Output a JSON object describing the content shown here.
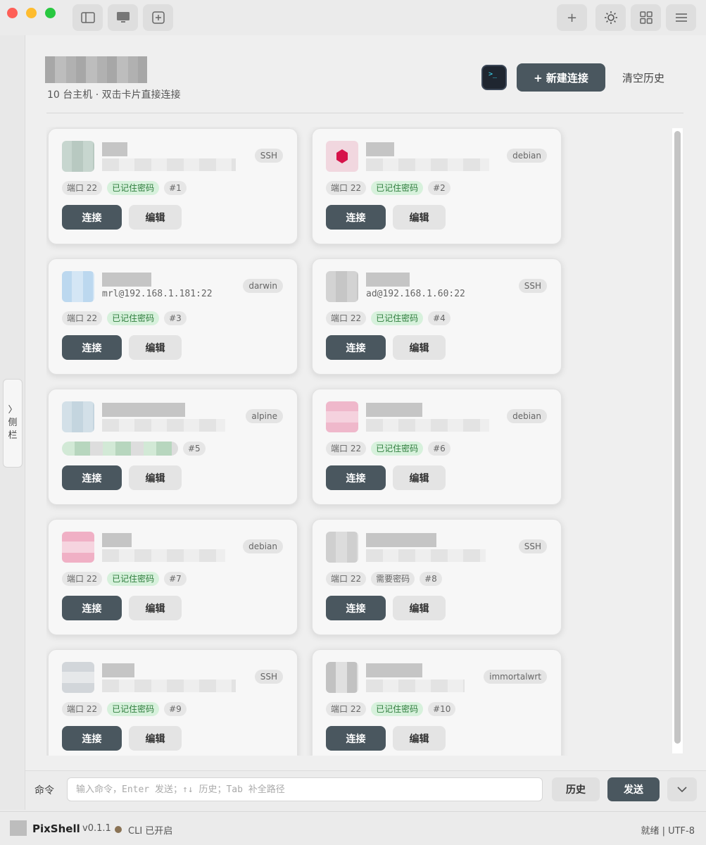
{
  "app": {
    "name": "PixShell",
    "version": "v0.1.1",
    "cli_status": "CLI 已开启",
    "status_right": "就绪 | UTF-8"
  },
  "titlebar": {
    "icons": [
      "sidebar-toggle-icon",
      "monitor-icon",
      "add-tab-icon",
      "plus-icon",
      "sun-icon",
      "grid-icon",
      "menu-icon"
    ],
    "plus_glyph": "+"
  },
  "sidebar_tab": {
    "arrow": "〉",
    "label_1": "侧",
    "label_2": "栏"
  },
  "header": {
    "subtitle": "10 台主机 · 双击卡片直接连接",
    "new_button": "+ 新建连接",
    "clear_button": "清空历史"
  },
  "colors": {
    "primary": "#4a575f",
    "green_chip_bg": "#d7f1dc",
    "green_chip_text": "#2f7d3d",
    "debian_red": "#d6134a"
  },
  "hosts": [
    {
      "os": "SSH",
      "address": "",
      "port": "端口 22",
      "auth": "已记住密码",
      "auth_ok": true,
      "index": "#1"
    },
    {
      "os": "debian",
      "address": "",
      "port": "端口 22",
      "auth": "已记住密码",
      "auth_ok": true,
      "index": "#2"
    },
    {
      "os": "darwin",
      "address": "mrl@192.168.1.181:22",
      "port": "端口 22",
      "auth": "已记住密码",
      "auth_ok": true,
      "index": "#3"
    },
    {
      "os": "SSH",
      "address": "ad@192.168.1.60:22",
      "port": "端口 22",
      "auth": "已记住密码",
      "auth_ok": true,
      "index": "#4"
    },
    {
      "os": "alpine",
      "address": "",
      "port": "",
      "auth": "",
      "auth_ok": true,
      "index": "#5"
    },
    {
      "os": "debian",
      "address": "",
      "port": "端口 22",
      "auth": "已记住密码",
      "auth_ok": true,
      "index": "#6"
    },
    {
      "os": "debian",
      "address": "",
      "port": "端口 22",
      "auth": "已记住密码",
      "auth_ok": true,
      "index": "#7"
    },
    {
      "os": "SSH",
      "address": "",
      "port": "端口 22",
      "auth": "需要密码",
      "auth_ok": false,
      "index": "#8"
    },
    {
      "os": "SSH",
      "address": "",
      "port": "端口 22",
      "auth": "已记住密码",
      "auth_ok": true,
      "index": "#9"
    },
    {
      "os": "immortalwrt",
      "address": "",
      "port": "端口 22",
      "auth": "已记住密码",
      "auth_ok": true,
      "index": "#10"
    }
  ],
  "card_buttons": {
    "connect": "连接",
    "edit": "编辑"
  },
  "command": {
    "label": "命令",
    "placeholder": "输入命令，Enter 发送；↑↓ 历史；Tab 补全路径",
    "history_button": "历史",
    "send_button": "发送"
  }
}
